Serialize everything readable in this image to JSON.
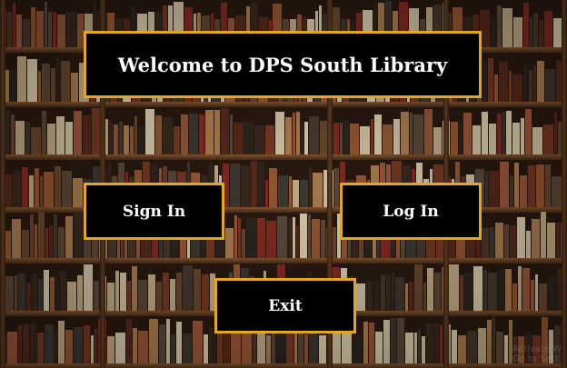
{
  "window": {
    "title": "Welcome to DPS South Library"
  },
  "buttons": {
    "sign_in": "Sign In",
    "log_in": "Log In",
    "exit": "Exit"
  },
  "watermark": {
    "line1": "Activate W",
    "line2": "Go to Setti"
  },
  "colors": {
    "panel_background": "#000000",
    "panel_border": "#e0a81c",
    "text": "#ffffff"
  }
}
